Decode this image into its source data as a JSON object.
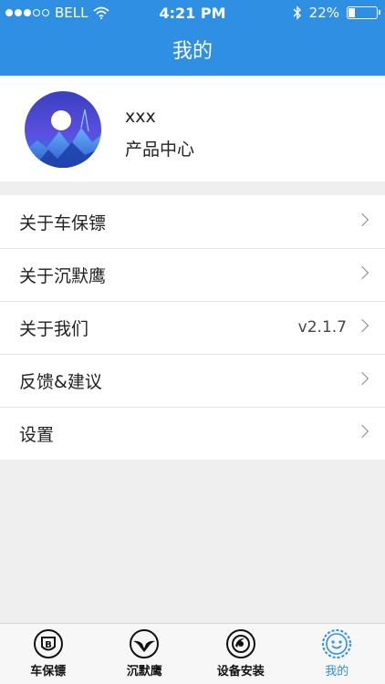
{
  "status_bar": {
    "carrier": "BELL",
    "time": "4:21 PM",
    "battery": "22%",
    "battery_level": 0.22,
    "signal_bars_filled": 3,
    "signal_bars_total": 5,
    "icons": [
      "wifi-icon",
      "bluetooth-icon",
      "battery-icon"
    ]
  },
  "nav": {
    "title": "我的"
  },
  "profile": {
    "name": "xxx",
    "subtitle": "产品中心",
    "avatar_icon": "moon-mountain-avatar"
  },
  "menu": {
    "items": [
      {
        "label": "关于车保镖",
        "value": ""
      },
      {
        "label": "关于沉默鹰",
        "value": ""
      },
      {
        "label": "关于我们",
        "value": "v2.1.7"
      },
      {
        "label": "反馈&建议",
        "value": ""
      },
      {
        "label": "设置",
        "value": ""
      }
    ]
  },
  "tabbar": {
    "tabs": [
      {
        "label": "车保镖",
        "icon": "shield-b-icon",
        "active": false
      },
      {
        "label": "沉默鹰",
        "icon": "eagle-icon",
        "active": false
      },
      {
        "label": "设备安装",
        "icon": "camera-lens-icon",
        "active": false
      },
      {
        "label": "我的",
        "icon": "smiley-face-icon",
        "active": true
      }
    ]
  },
  "colors": {
    "accent": "#2f8fe3",
    "background": "#efefef",
    "tabbar_background": "#f7f7f7"
  }
}
